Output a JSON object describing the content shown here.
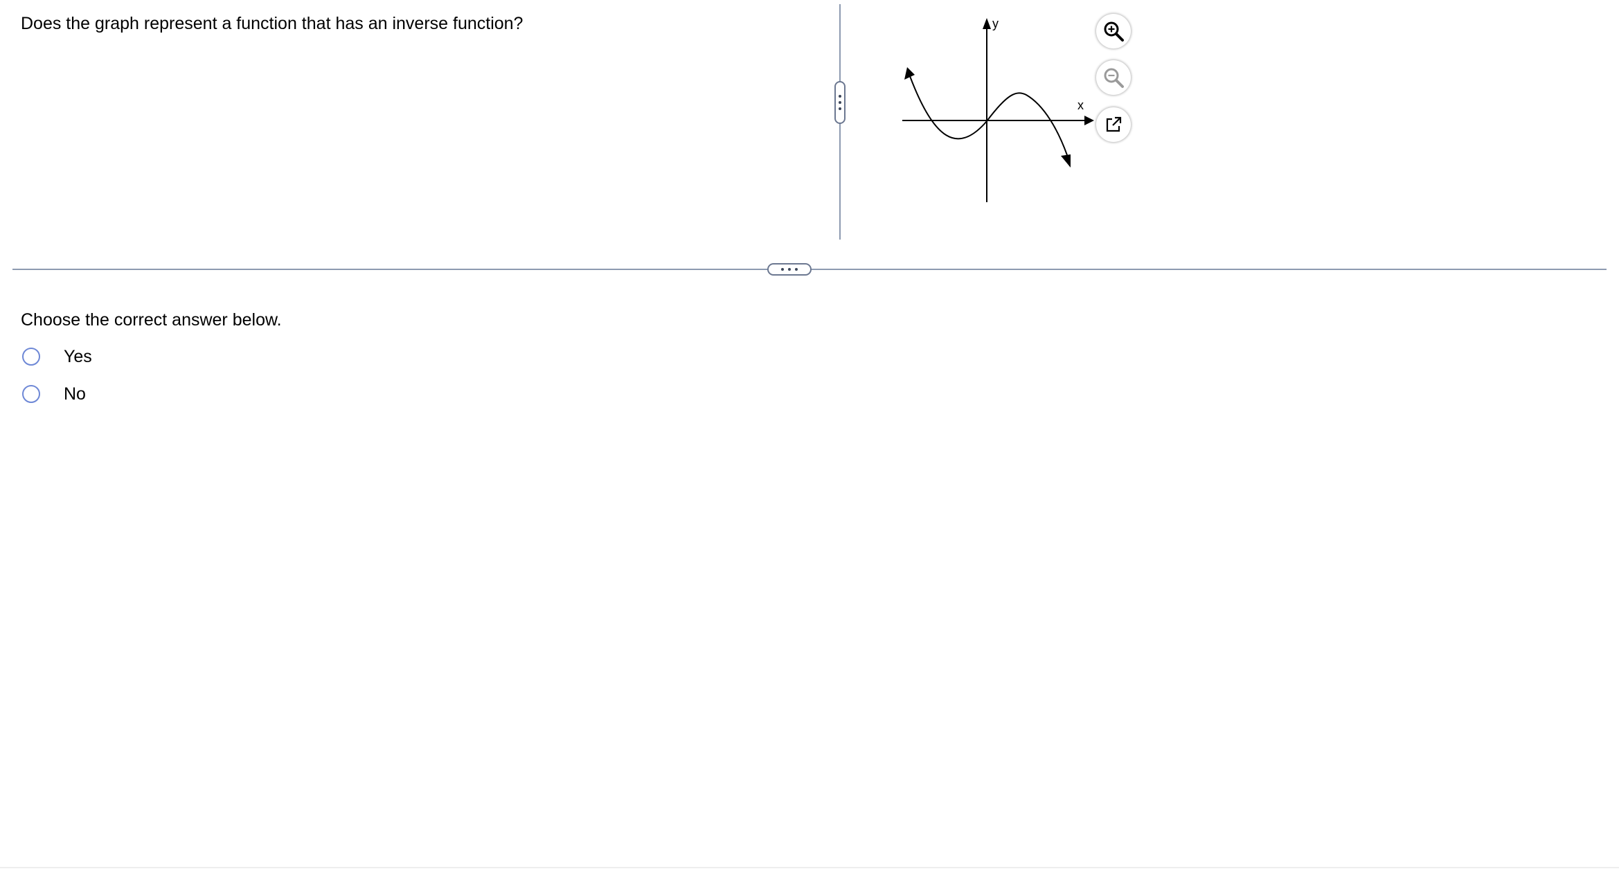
{
  "question": {
    "text": "Does the graph represent a function that has an inverse function?"
  },
  "graph": {
    "x_axis_label": "x",
    "y_axis_label": "y"
  },
  "graph_tools": {
    "zoom_in_icon": "zoom-in-icon",
    "zoom_out_icon": "zoom-out-icon",
    "popout_icon": "external-link-icon"
  },
  "answer": {
    "prompt": "Choose the correct answer below.",
    "options": [
      {
        "label": "Yes",
        "selected": false
      },
      {
        "label": "No",
        "selected": false
      }
    ]
  },
  "colors": {
    "radio_border": "#6e88d6",
    "splitter": "#8d9ab0"
  }
}
